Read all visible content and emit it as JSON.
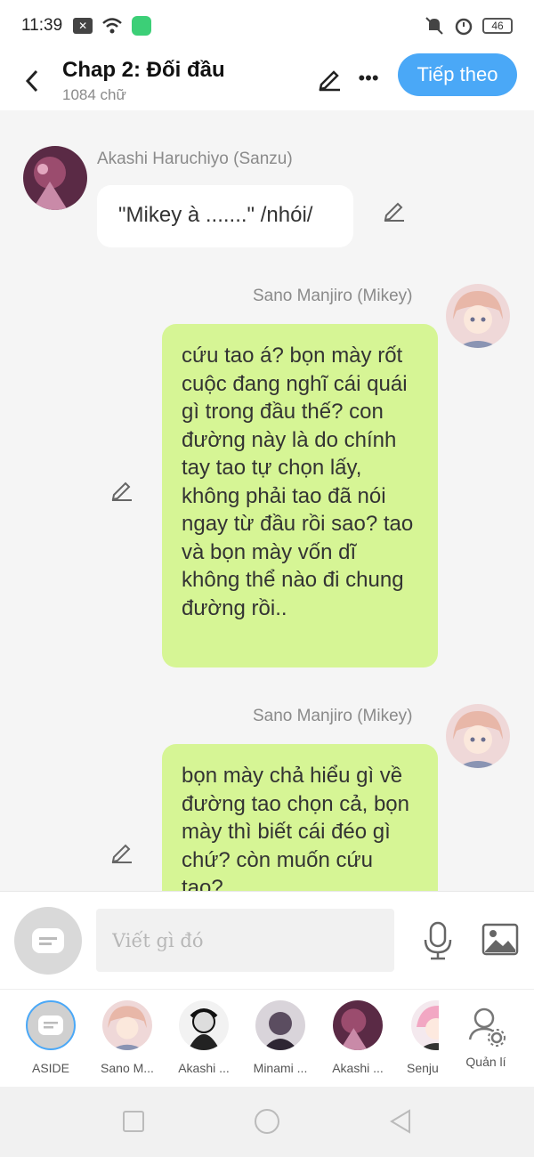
{
  "status_bar": {
    "time": "11:39",
    "battery": "46"
  },
  "header": {
    "title": "Chap 2: Đối đầu",
    "word_count": "1084 chữ",
    "next_button": "Tiếp theo"
  },
  "messages": [
    {
      "side": "left",
      "name": "Akashi Haruchiyo (Sanzu)",
      "text": "\"Mikey à .......\" /nhói/"
    },
    {
      "side": "right",
      "name": "Sano Manjiro (Mikey)",
      "text": "cứu tao á? bọn mày rốt cuộc đang nghĩ cái quái gì trong đầu thế? con đường này là do chính tay tao tự chọn lấy, không phải tao đã nói ngay từ đầu rồi sao? tao và bọn mày vốn dĩ không thể nào đi chung đường rồi.."
    },
    {
      "side": "right",
      "name": "Sano Manjiro (Mikey)",
      "text": "bọn mày chả hiểu gì về đường tao chọn cả, bọn mày thì biết cái đéo gì chứ? còn muốn cứu tao?"
    }
  ],
  "composer": {
    "placeholder": "Viết gì đó"
  },
  "characters": [
    {
      "label": "ASIDE"
    },
    {
      "label": "Sano M..."
    },
    {
      "label": "Akashi ..."
    },
    {
      "label": "Minami ..."
    },
    {
      "label": "Akashi ..."
    },
    {
      "label": "Senju"
    },
    {
      "label": "Quản lí"
    }
  ],
  "colors": {
    "accent": "#4aa8f7",
    "right_bubble": "#d6f595",
    "left_bubble": "#ffffff"
  }
}
